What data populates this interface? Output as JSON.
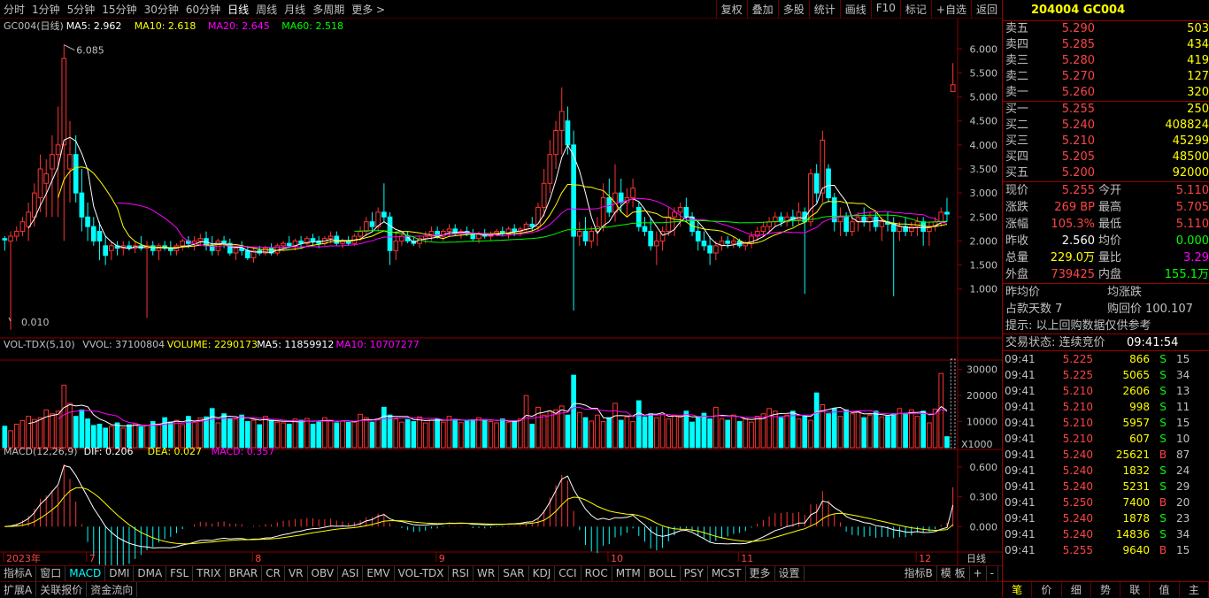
{
  "top_tabs": [
    "分时",
    "1分钟",
    "5分钟",
    "15分钟",
    "30分钟",
    "60分钟",
    "日线",
    "周线",
    "月线",
    "多周期",
    "更多 >"
  ],
  "top_tools": [
    "复权",
    "叠加",
    "多股",
    "统计",
    "画线",
    "F10",
    "标记",
    "+自选",
    "返回"
  ],
  "main_legend": {
    "name": "GC004(日线)",
    "ma5": "MA5: 2.962",
    "ma10": "MA10: 2.618",
    "ma20": "MA20: 2.645",
    "ma60": "MA60: 2.518"
  },
  "price_high_label": "6.085",
  "price_low_label": "0.010",
  "price_axis": [
    "6.000",
    "5.500",
    "5.000",
    "4.500",
    "4.000",
    "3.500",
    "3.000",
    "2.500",
    "2.000",
    "1.500",
    "1.000"
  ],
  "vol_legend": {
    "name": "VOL-TDX(5,10)",
    "vvol": "VVOL: 37100804",
    "volume": "VOLUME: 2290173",
    "ma5": "MA5: 11859912",
    "ma10": "MA10: 10707277"
  },
  "vol_axis": [
    "30000",
    "20000",
    "10000"
  ],
  "vol_unit": "X1000",
  "macd_legend": {
    "name": "MACD(12,26,9)",
    "dif": "DIF: 0.206",
    "dea": "DEA: 0.027",
    "macd": "MACD: 0.357"
  },
  "macd_axis": [
    "0.600",
    "0.300",
    "0.000"
  ],
  "date_axis": [
    {
      "label": "2023年",
      "i": 0
    },
    {
      "label": "7",
      "i": 14
    },
    {
      "label": "8",
      "i": 42
    },
    {
      "label": "9",
      "i": 73
    },
    {
      "label": "10",
      "i": 102
    },
    {
      "label": "11",
      "i": 124
    },
    {
      "label": "12",
      "i": 154
    }
  ],
  "period_label": "日线",
  "indicator_tabs": [
    "指标A",
    "窗口",
    "MACD",
    "DMI",
    "DMA",
    "FSL",
    "TRIX",
    "BRAR",
    "CR",
    "VR",
    "OBV",
    "ASI",
    "EMV",
    "VOL-TDX",
    "RSI",
    "WR",
    "SAR",
    "KDJ",
    "CCI",
    "ROC",
    "MTM",
    "BOLL",
    "PSY",
    "MCST",
    "更多",
    "设置"
  ],
  "indicator_right": [
    "指标B",
    "模 板",
    "+",
    "-"
  ],
  "bottom_tabs": [
    "扩展A",
    "关联报价",
    "资金流向"
  ],
  "colors": {
    "up": "#ff3333",
    "down": "#00ffff",
    "ma5": "#ffffff",
    "ma10": "#ffff00",
    "ma20": "#ff00ff",
    "ma60": "#00ff00",
    "grid": "#8b0000"
  },
  "quote": {
    "title": "204004 GC004",
    "asks": [
      {
        "l": "卖五",
        "p": "5.290",
        "v": "503"
      },
      {
        "l": "卖四",
        "p": "5.285",
        "v": "434"
      },
      {
        "l": "卖三",
        "p": "5.280",
        "v": "419"
      },
      {
        "l": "卖二",
        "p": "5.270",
        "v": "127"
      },
      {
        "l": "卖一",
        "p": "5.260",
        "v": "320"
      }
    ],
    "bids": [
      {
        "l": "买一",
        "p": "5.255",
        "v": "250"
      },
      {
        "l": "买二",
        "p": "5.240",
        "v": "408824"
      },
      {
        "l": "买三",
        "p": "5.210",
        "v": "45299"
      },
      {
        "l": "买四",
        "p": "5.205",
        "v": "48500"
      },
      {
        "l": "买五",
        "p": "5.200",
        "v": "92000"
      }
    ],
    "stats": [
      {
        "l1": "现价",
        "v1": "5.255",
        "c1": "red",
        "l2": "今开",
        "v2": "5.110",
        "c2": "red"
      },
      {
        "l1": "涨跌",
        "v1": "269 BP",
        "c1": "red",
        "l2": "最高",
        "v2": "5.705",
        "c2": "red"
      },
      {
        "l1": "涨幅",
        "v1": "105.3%",
        "c1": "red",
        "l2": "最低",
        "v2": "5.110",
        "c2": "red"
      },
      {
        "l1": "昨收",
        "v1": "2.560",
        "c1": "wht",
        "l2": "均价",
        "v2": "0.000",
        "c2": "grn"
      },
      {
        "l1": "总量",
        "v1": "229.0万",
        "c1": "yel",
        "l2": "量比",
        "v2": "3.29",
        "c2": "mag"
      },
      {
        "l1": "外盘",
        "v1": "739425",
        "c1": "red",
        "l2": "内盘",
        "v2": "155.1万",
        "c2": "grn"
      }
    ],
    "extra1": "昨均价",
    "extra2": "均涨跌",
    "extra3": "占款天数 7",
    "extra4": "购回价 100.107",
    "hint": "提示: 以上回购数据仅供参考",
    "status": "交易状态: 连续竞价",
    "status_time": "09:41:54",
    "ticks": [
      {
        "t": "09:41",
        "p": "5.225",
        "v": "866",
        "s": "S",
        "n": "15"
      },
      {
        "t": "09:41",
        "p": "5.225",
        "v": "5065",
        "s": "S",
        "n": "34"
      },
      {
        "t": "09:41",
        "p": "5.210",
        "v": "2606",
        "s": "S",
        "n": "13"
      },
      {
        "t": "09:41",
        "p": "5.210",
        "v": "998",
        "s": "S",
        "n": "11"
      },
      {
        "t": "09:41",
        "p": "5.210",
        "v": "5957",
        "s": "S",
        "n": "15"
      },
      {
        "t": "09:41",
        "p": "5.210",
        "v": "607",
        "s": "S",
        "n": "10"
      },
      {
        "t": "09:41",
        "p": "5.240",
        "v": "25621",
        "s": "B",
        "n": "87"
      },
      {
        "t": "09:41",
        "p": "5.240",
        "v": "1832",
        "s": "S",
        "n": "24"
      },
      {
        "t": "09:41",
        "p": "5.240",
        "v": "5231",
        "s": "S",
        "n": "29"
      },
      {
        "t": "09:41",
        "p": "5.250",
        "v": "7400",
        "s": "B",
        "n": "20"
      },
      {
        "t": "09:41",
        "p": "5.240",
        "v": "1878",
        "s": "S",
        "n": "23"
      },
      {
        "t": "09:41",
        "p": "5.240",
        "v": "14836",
        "s": "S",
        "n": "34"
      },
      {
        "t": "09:41",
        "p": "5.255",
        "v": "9640",
        "s": "B",
        "n": "15"
      }
    ],
    "tabs": [
      "笔",
      "价",
      "细",
      "势",
      "联",
      "值",
      "主"
    ]
  },
  "chart_data": {
    "type": "candlestick",
    "title": "GC004(日线)",
    "ylim": [
      0.01,
      6.085
    ],
    "candles": [
      [
        2.05,
        2.1,
        1.8,
        2.02
      ],
      [
        2,
        2.2,
        0.15,
        2.1
      ],
      [
        2.1,
        2.3,
        2,
        2.2
      ],
      [
        2.2,
        2.5,
        2.1,
        2.4
      ],
      [
        2.3,
        2.8,
        2,
        2.6
      ],
      [
        2.5,
        3.2,
        2.3,
        3
      ],
      [
        2.9,
        3.8,
        2.6,
        3.5
      ],
      [
        3.2,
        3.7,
        2.5,
        3.4
      ],
      [
        3.5,
        4.2,
        2.5,
        3.8
      ],
      [
        3.8,
        4.8,
        2.5,
        4
      ],
      [
        4,
        6.085,
        2,
        5.8
      ],
      [
        3.5,
        4.5,
        2.8,
        3.8
      ],
      [
        3.8,
        4.2,
        2.8,
        3
      ],
      [
        3,
        3.5,
        2.2,
        2.5
      ],
      [
        2.5,
        2.8,
        2,
        2.3
      ],
      [
        2.3,
        2.5,
        1.9,
        2
      ],
      [
        2.2,
        2.4,
        1.6,
        2
      ],
      [
        1.9,
        2.1,
        1.5,
        1.7
      ],
      [
        1.8,
        2,
        1.6,
        1.9
      ],
      [
        1.9,
        2,
        1.7,
        1.85
      ],
      [
        1.85,
        2,
        1.7,
        1.9
      ],
      [
        1.9,
        2,
        1.8,
        1.85
      ],
      [
        1.85,
        2,
        1.75,
        1.9
      ],
      [
        1.9,
        2.1,
        1.8,
        1.85
      ],
      [
        1.85,
        2,
        0.4,
        1.9
      ],
      [
        1.9,
        2,
        1.7,
        1.8
      ],
      [
        1.8,
        1.95,
        1.6,
        1.9
      ],
      [
        1.9,
        2,
        1.8,
        1.85
      ],
      [
        1.85,
        2,
        1.7,
        1.8
      ],
      [
        1.8,
        1.95,
        1.7,
        1.9
      ],
      [
        1.9,
        2.05,
        1.8,
        2
      ],
      [
        2,
        2.1,
        1.85,
        1.95
      ],
      [
        1.95,
        2.1,
        1.8,
        2
      ],
      [
        2,
        2.15,
        1.9,
        2.05
      ],
      [
        2.05,
        2.2,
        1.8,
        1.9
      ],
      [
        1.9,
        2.1,
        1.7,
        1.8
      ],
      [
        1.8,
        2.05,
        1.7,
        2
      ],
      [
        2,
        2.1,
        1.85,
        1.95
      ],
      [
        1.95,
        2.05,
        1.7,
        1.75
      ],
      [
        1.75,
        1.9,
        1.6,
        1.85
      ],
      [
        1.85,
        2,
        1.7,
        1.8
      ],
      [
        1.8,
        1.9,
        1.6,
        1.65
      ],
      [
        1.65,
        1.85,
        1.55,
        1.8
      ],
      [
        1.8,
        1.9,
        1.7,
        1.75
      ],
      [
        1.75,
        1.9,
        1.7,
        1.85
      ],
      [
        1.85,
        1.95,
        1.7,
        1.75
      ],
      [
        1.75,
        1.95,
        1.7,
        1.9
      ],
      [
        1.9,
        2,
        1.8,
        1.95
      ],
      [
        1.95,
        2.1,
        1.85,
        1.9
      ],
      [
        1.9,
        2.05,
        1.8,
        2
      ],
      [
        2,
        2.1,
        1.85,
        1.95
      ],
      [
        1.95,
        2.1,
        1.9,
        2.05
      ],
      [
        2.05,
        2.15,
        1.9,
        2
      ],
      [
        2,
        2.1,
        1.85,
        1.95
      ],
      [
        1.95,
        2.1,
        1.9,
        2.05
      ],
      [
        2.05,
        2.2,
        1.95,
        2.1
      ],
      [
        2.1,
        2.2,
        1.9,
        1.95
      ],
      [
        1.95,
        2.05,
        1.85,
        2
      ],
      [
        2,
        2.1,
        1.9,
        1.95
      ],
      [
        1.95,
        2.15,
        1.9,
        2.1
      ],
      [
        2.1,
        2.3,
        2,
        2.2
      ],
      [
        2.2,
        2.5,
        2.1,
        2.4
      ],
      [
        2.4,
        2.6,
        2.2,
        2.3
      ],
      [
        2.3,
        2.7,
        2.2,
        2.6
      ],
      [
        2.6,
        3.2,
        2.4,
        2.5
      ],
      [
        2.5,
        2.6,
        1.5,
        1.8
      ],
      [
        1.8,
        2.2,
        1.6,
        2
      ],
      [
        2,
        2.2,
        1.9,
        2.1
      ],
      [
        2.1,
        2.2,
        1.95,
        2
      ],
      [
        2,
        2.1,
        1.9,
        1.95
      ],
      [
        1.95,
        2.1,
        1.85,
        2.05
      ],
      [
        2.05,
        2.2,
        1.95,
        2.1
      ],
      [
        2.1,
        2.3,
        2,
        2.2
      ],
      [
        2.2,
        2.3,
        2.05,
        2.1
      ],
      [
        2.1,
        2.25,
        2,
        2.2
      ],
      [
        2.2,
        2.35,
        2.1,
        2.25
      ],
      [
        2.25,
        2.35,
        2.1,
        2.15
      ],
      [
        2.15,
        2.25,
        2.05,
        2.2
      ],
      [
        2.2,
        2.3,
        2.1,
        2.15
      ],
      [
        2.15,
        2.25,
        2,
        2.05
      ],
      [
        2.05,
        2.2,
        1.95,
        2.15
      ],
      [
        2.15,
        2.25,
        2.05,
        2.1
      ],
      [
        2.1,
        2.2,
        2,
        2.15
      ],
      [
        2.15,
        2.25,
        2.1,
        2.2
      ],
      [
        2.2,
        2.3,
        2.1,
        2.15
      ],
      [
        2.15,
        2.3,
        2.05,
        2.25
      ],
      [
        2.25,
        2.35,
        2.1,
        2.2
      ],
      [
        2.2,
        2.3,
        2.1,
        2.25
      ],
      [
        2.25,
        2.4,
        2.2,
        2.35
      ],
      [
        2.35,
        2.5,
        2.2,
        2.3
      ],
      [
        2.3,
        2.8,
        2.2,
        2.7
      ],
      [
        2.7,
        3.5,
        2.5,
        3.2
      ],
      [
        3.2,
        4.1,
        3,
        3.8
      ],
      [
        3.8,
        4.5,
        3.5,
        4.3
      ],
      [
        4.3,
        5.2,
        3.8,
        4.7
      ],
      [
        4.5,
        4.8,
        3.8,
        4
      ],
      [
        4,
        4.3,
        0.55,
        2.1
      ],
      [
        2.1,
        2.4,
        1.9,
        2.2
      ],
      [
        2.2,
        2.5,
        1.9,
        2
      ],
      [
        2,
        2.3,
        1.85,
        2.2
      ],
      [
        2.2,
        2.5,
        1.9,
        2.3
      ],
      [
        2.3,
        3.2,
        2.2,
        2.9
      ],
      [
        2.9,
        3.3,
        2.5,
        2.6
      ],
      [
        2.6,
        3.6,
        2.4,
        3
      ],
      [
        3,
        3.3,
        2.6,
        2.8
      ],
      [
        2.8,
        3.1,
        2.5,
        2.9
      ],
      [
        2.9,
        3.3,
        2.7,
        3.1
      ],
      [
        2.7,
        2.8,
        2.2,
        2.3
      ],
      [
        2.3,
        2.5,
        2.1,
        2.2
      ],
      [
        2.2,
        2.5,
        1.8,
        1.9
      ],
      [
        1.9,
        2.2,
        1.5,
        2
      ],
      [
        2,
        2.3,
        1.8,
        2.2
      ],
      [
        2.2,
        2.7,
        2.1,
        2.5
      ],
      [
        2.5,
        2.7,
        2.1,
        2.6
      ],
      [
        2.6,
        2.8,
        2.3,
        2.7
      ],
      [
        2.7,
        2.9,
        2.4,
        2.5
      ],
      [
        2.5,
        2.6,
        2.1,
        2.2
      ],
      [
        2.2,
        2.4,
        1.8,
        2
      ],
      [
        2,
        2.2,
        1.8,
        1.9
      ],
      [
        1.9,
        2.1,
        1.5,
        1.75
      ],
      [
        1.75,
        2,
        1.6,
        1.9
      ],
      [
        1.9,
        2.1,
        1.8,
        2
      ],
      [
        2,
        2.1,
        1.85,
        1.95
      ],
      [
        1.95,
        2.1,
        1.85,
        2
      ],
      [
        2,
        2.05,
        1.85,
        1.9
      ],
      [
        1.9,
        2,
        1.8,
        1.95
      ],
      [
        1.95,
        2.2,
        1.85,
        2.1
      ],
      [
        2.1,
        2.3,
        2,
        2.2
      ],
      [
        2.2,
        2.4,
        2.1,
        2.3
      ],
      [
        2.3,
        2.5,
        2.2,
        2.4
      ],
      [
        2.4,
        2.6,
        2.3,
        2.5
      ],
      [
        2.5,
        2.6,
        2.3,
        2.4
      ],
      [
        2.4,
        2.6,
        2.3,
        2.5
      ],
      [
        2.5,
        2.65,
        2.3,
        2.45
      ],
      [
        2.45,
        2.8,
        2.35,
        2.6
      ],
      [
        2.6,
        2.7,
        0.9,
        2.4
      ],
      [
        2.4,
        3.5,
        2.3,
        3.4
      ],
      [
        3.4,
        3.6,
        2.8,
        3
      ],
      [
        3,
        4.3,
        2.8,
        4.1
      ],
      [
        3.5,
        3.6,
        2.8,
        2.9
      ],
      [
        2.9,
        3,
        2.2,
        2.4
      ],
      [
        2.4,
        2.7,
        2.1,
        2.5
      ],
      [
        2.5,
        2.6,
        2.1,
        2.2
      ],
      [
        2.2,
        2.5,
        2.1,
        2.4
      ],
      [
        2.4,
        2.6,
        2.2,
        2.5
      ],
      [
        2.5,
        2.7,
        2.3,
        2.4
      ],
      [
        2.4,
        2.6,
        2.2,
        2.5
      ],
      [
        2.5,
        2.6,
        2.2,
        2.3
      ],
      [
        2.3,
        2.5,
        2,
        2.4
      ],
      [
        2.4,
        2.6,
        2.2,
        2.35
      ],
      [
        2.35,
        2.5,
        0.85,
        2.2
      ],
      [
        2.2,
        2.4,
        2,
        2.3
      ],
      [
        2.3,
        2.5,
        2.1,
        2.2
      ],
      [
        2.2,
        2.4,
        2.1,
        2.3
      ],
      [
        2.3,
        2.5,
        2.1,
        2.4
      ],
      [
        2.4,
        2.5,
        1.9,
        2.2
      ],
      [
        2.2,
        2.4,
        1.9,
        2.3
      ],
      [
        2.3,
        2.5,
        2.2,
        2.4
      ],
      [
        2.4,
        2.7,
        2.3,
        2.6
      ],
      [
        2.6,
        2.9,
        2.4,
        2.56
      ],
      [
        5.11,
        5.705,
        5.11,
        5.255
      ]
    ],
    "volume_x1000": [
      8200,
      6500,
      9000,
      10400,
      12000,
      10800,
      11500,
      14500,
      13000,
      14000,
      24000,
      17000,
      12000,
      14500,
      11000,
      8500,
      9000,
      7500,
      8200,
      9500,
      7500,
      8800,
      9200,
      8000,
      8600,
      10000,
      9000,
      11500,
      9800,
      10500,
      8800,
      12000,
      9800,
      11400,
      11800,
      15000,
      9500,
      13000,
      11000,
      11000,
      12500,
      10000,
      10500,
      8800,
      12000,
      10500,
      9800,
      9500,
      9000,
      11000,
      10500,
      11200,
      9000,
      9800,
      11500,
      10500,
      9500,
      10200,
      9700,
      9800,
      12800,
      11500,
      9800,
      11000,
      15500,
      12500,
      11000,
      9800,
      10800,
      10000,
      11800,
      9500,
      10500,
      11000,
      9800,
      12000,
      10800,
      9600,
      10500,
      10600,
      11500,
      10800,
      10000,
      9500,
      11000,
      9800,
      10400,
      11000,
      20000,
      9000,
      15500,
      12500,
      14000,
      14500,
      16000,
      12500,
      27800,
      13500,
      11500,
      10200,
      12500,
      10000,
      11500,
      17000,
      10500,
      11800,
      10000,
      18000,
      11800,
      13000,
      11500,
      12800,
      11000,
      12500,
      11700,
      14000,
      9800,
      11500,
      13200,
      11000,
      15500,
      11000,
      10500,
      12500,
      10000,
      11000,
      9800,
      12000,
      13000,
      15000,
      14000,
      11500,
      12500,
      14000,
      11000,
      12000,
      10500,
      21000,
      16500,
      13000,
      15000,
      12000,
      14500,
      13000,
      13800,
      11500,
      12500,
      14000,
      11800,
      12000,
      13000,
      15000,
      13200,
      14500,
      12000,
      14000,
      9500,
      14800,
      28500,
      4200
    ],
    "ma_last": {
      "ma5": 2.962,
      "ma10": 2.618,
      "ma20": 2.645,
      "ma60": 2.518
    },
    "macd_last": {
      "dif": 0.206,
      "dea": 0.027,
      "macd": 0.357
    },
    "vol_ylim": [
      0,
      35000
    ],
    "macd_ylim": [
      -0.3,
      0.75
    ]
  }
}
